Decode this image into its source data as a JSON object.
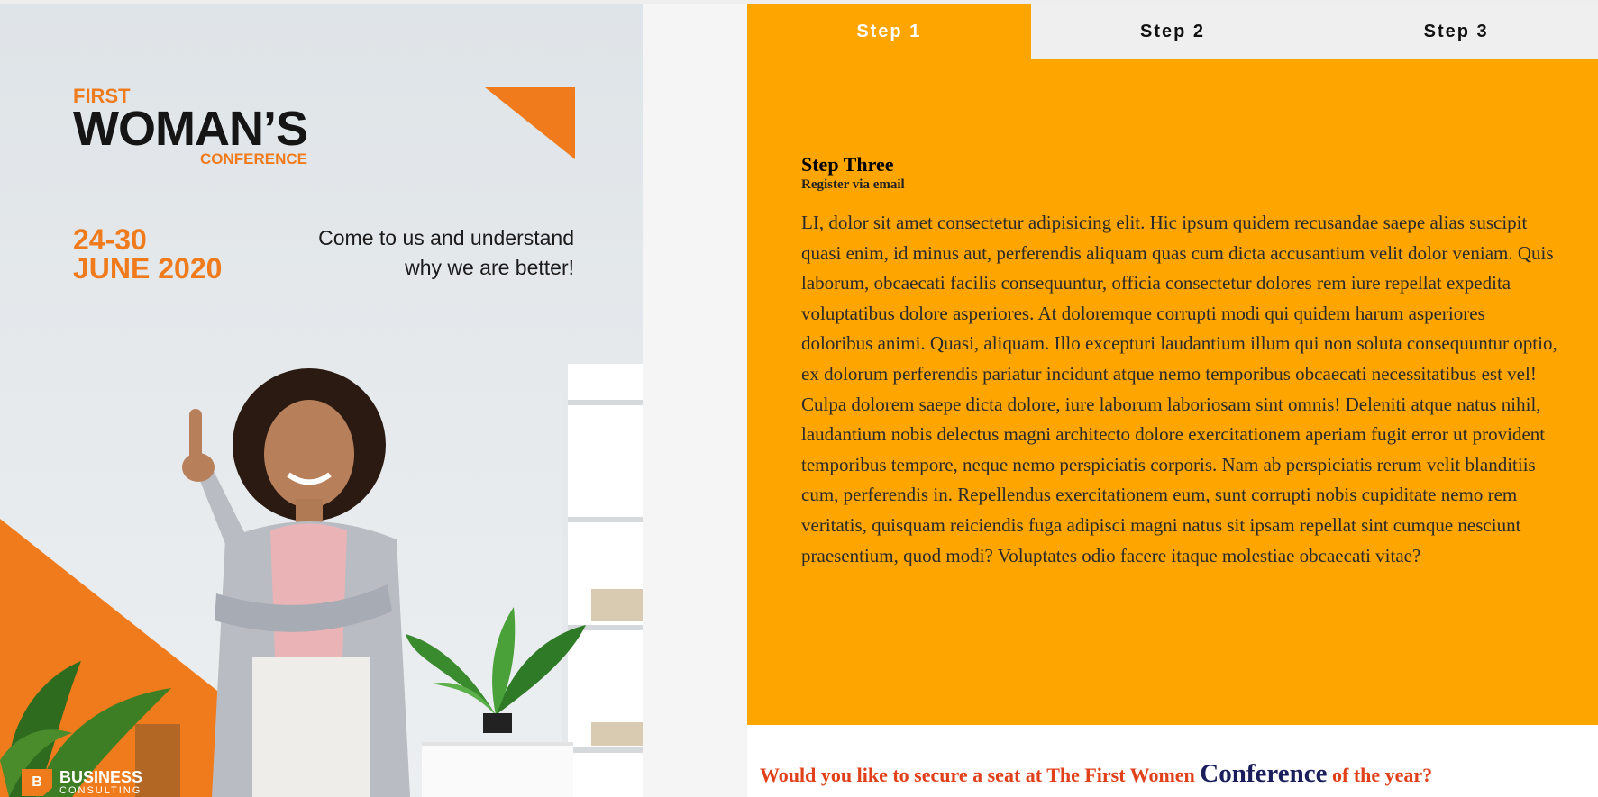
{
  "poster": {
    "brand_first": "FIRST",
    "brand_main": "WOMAN’S",
    "brand_sub": "CONFERENCE",
    "date_line1": "24-30",
    "date_line2": "JUNE 2020",
    "tagline_line1": "Come to us and understand",
    "tagline_line2": "why we are better!",
    "logo_mark": "B",
    "logo_line1": "BUSINESS",
    "logo_line2": "CONSULTING"
  },
  "tabs": [
    {
      "label": "Step 1",
      "active": true
    },
    {
      "label": "Step 2",
      "active": false
    },
    {
      "label": "Step 3",
      "active": false
    }
  ],
  "panel": {
    "title": "Step Three",
    "subtitle": "Register via email",
    "body": "LI, dolor sit amet consectetur adipisicing elit. Hic ipsum quidem recusandae saepe alias suscipit quasi enim, id minus aut, perferendis aliquam quas cum dicta accusantium velit dolor veniam. Quis laborum, obcaecati facilis consequuntur, officia consectetur dolores rem iure repellat expedita voluptatibus dolore asperiores. At doloremque corrupti modi qui quidem harum asperiores doloribus animi. Quasi, aliquam. Illo excepturi laudantium illum qui non soluta consequuntur optio, ex dolorum perferendis pariatur incidunt atque nemo temporibus obcaecati necessitatibus est vel! Culpa dolorem saepe dicta dolore, iure laborum laboriosam sint omnis! Deleniti atque natus nihil, laudantium nobis delectus magni architecto dolore exercitationem aperiam fugit error ut provident temporibus tempore, neque nemo perspiciatis corporis. Nam ab perspiciatis rerum velit blanditiis cum, perferendis in. Repellendus exercitationem eum, sunt corrupti nobis cupiditate nemo rem veritatis, quisquam reiciendis fuga adipisci magni natus sit ipsam repellat sint cumque nesciunt praesentium, quod modi? Voluptates odio facere itaque molestiae obcaecati vitae?"
  },
  "question": {
    "before": "Would you like to secure a seat at The First Women ",
    "highlight": "Conference",
    "after": " of the year?"
  },
  "colors": {
    "accent_orange": "#ffa500",
    "poster_orange": "#f07b1d",
    "question_red": "#e0411a",
    "question_navy": "#1a1f5c"
  },
  "icons": [
    "orange-triangle-graphic",
    "business-consulting-logo-icon"
  ]
}
